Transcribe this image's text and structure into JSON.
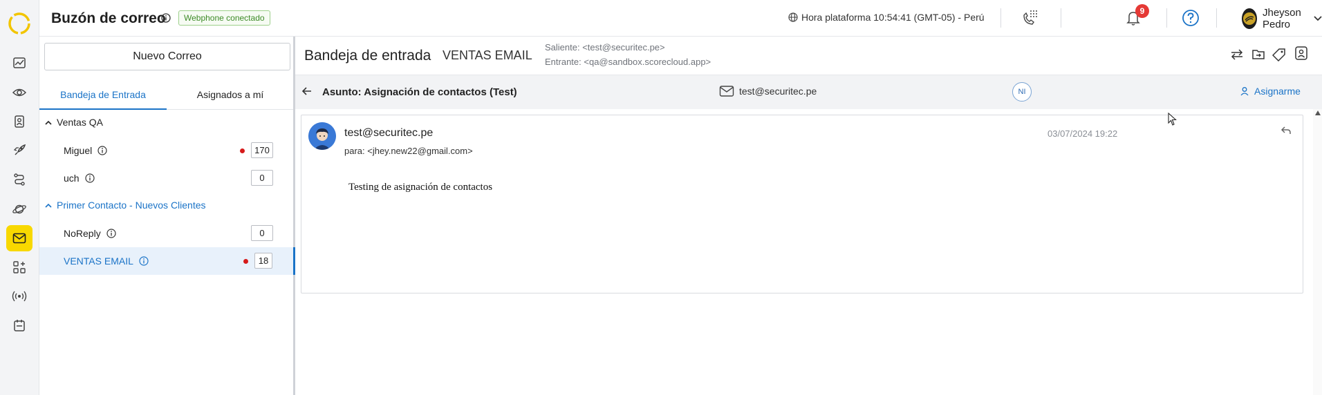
{
  "header": {
    "title": "Buzón de correo",
    "status": "Webphone conectado",
    "clock": "Hora plataforma 10:54:41 (GMT-05) - Perú",
    "notifications_count": "9",
    "user_name": "Jheyson Pedro",
    "icons": [
      "info-icon",
      "globe-icon",
      "dialpad-phone-icon",
      "bell-icon",
      "help-icon",
      "chevron-down-icon"
    ]
  },
  "rail": {
    "icons": [
      "app-logo",
      "activity-icon",
      "eye-icon",
      "contact-card-icon",
      "rocket-icon",
      "flow-icon",
      "planet-icon",
      "mail-icon",
      "apps-icon",
      "broadcast-icon",
      "calendar-icon"
    ],
    "active": "mail-icon",
    "accent": "#f8d800"
  },
  "sidebar": {
    "new_mail": "Nuevo Correo",
    "tabs": [
      "Bandeja de Entrada",
      "Asignados a mí"
    ],
    "active_tab": "Bandeja de Entrada",
    "groups": [
      {
        "name": "Ventas QA",
        "items": [
          {
            "label": "Miguel",
            "count": "170",
            "unread_dot": true
          },
          {
            "label": "uch",
            "count": "0",
            "unread_dot": false
          }
        ]
      },
      {
        "name": "Primer Contacto - Nuevos Clientes",
        "items": [
          {
            "label": "NoReply",
            "count": "0",
            "unread_dot": false
          },
          {
            "label": "VENTAS EMAIL",
            "count": "18",
            "unread_dot": true,
            "selected": true
          }
        ]
      }
    ]
  },
  "main": {
    "title": "Bandeja de entrada",
    "inbox_name": "VENTAS EMAIL",
    "outgoing": "Saliente: <test@securitec.pe>",
    "incoming": "Entrante: <qa@sandbox.scorecloud.app>",
    "toolbar_icons": [
      "transfer-icon",
      "move-folder-icon",
      "tag-icon",
      "contact-icon"
    ],
    "subject": "Asunto: Asignación de contactos (Test)",
    "subject_email": "test@securitec.pe",
    "assignee_initials": "NI",
    "assign_label": "Asignarme",
    "message": {
      "sender": "test@securitec.pe",
      "recipient": "para: <jhey.new22@gmail.com>",
      "date": "03/07/2024 19:22",
      "body": "Testing de asignación de contactos"
    }
  },
  "colors": {
    "primary": "#1a73c7",
    "badge_green": "#3d8b27",
    "notification": "#e53935",
    "unread_dot": "#d61a1a"
  }
}
